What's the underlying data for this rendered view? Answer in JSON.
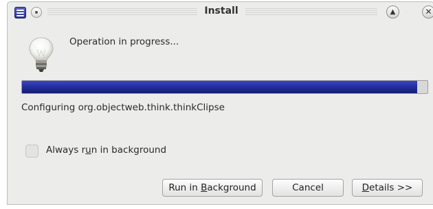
{
  "window": {
    "title": "Install"
  },
  "message": "Operation in progress...",
  "progress": {
    "fraction": 0.975,
    "fill_color": "#25309f"
  },
  "task": "Configuring org.objectweb.think.thinkClipse",
  "always_background": {
    "label_pre": "Always r",
    "label_mnemonic": "u",
    "label_post": "n in background",
    "checked": false
  },
  "buttons": {
    "run_pre": "Run in ",
    "run_mnemonic": "B",
    "run_post": "ackground",
    "cancel": "Cancel",
    "details_mnemonic": "D",
    "details_post": "etails >>"
  },
  "icons": {
    "app": "eclipse-app-icon",
    "info": "lightbulb-icon"
  }
}
